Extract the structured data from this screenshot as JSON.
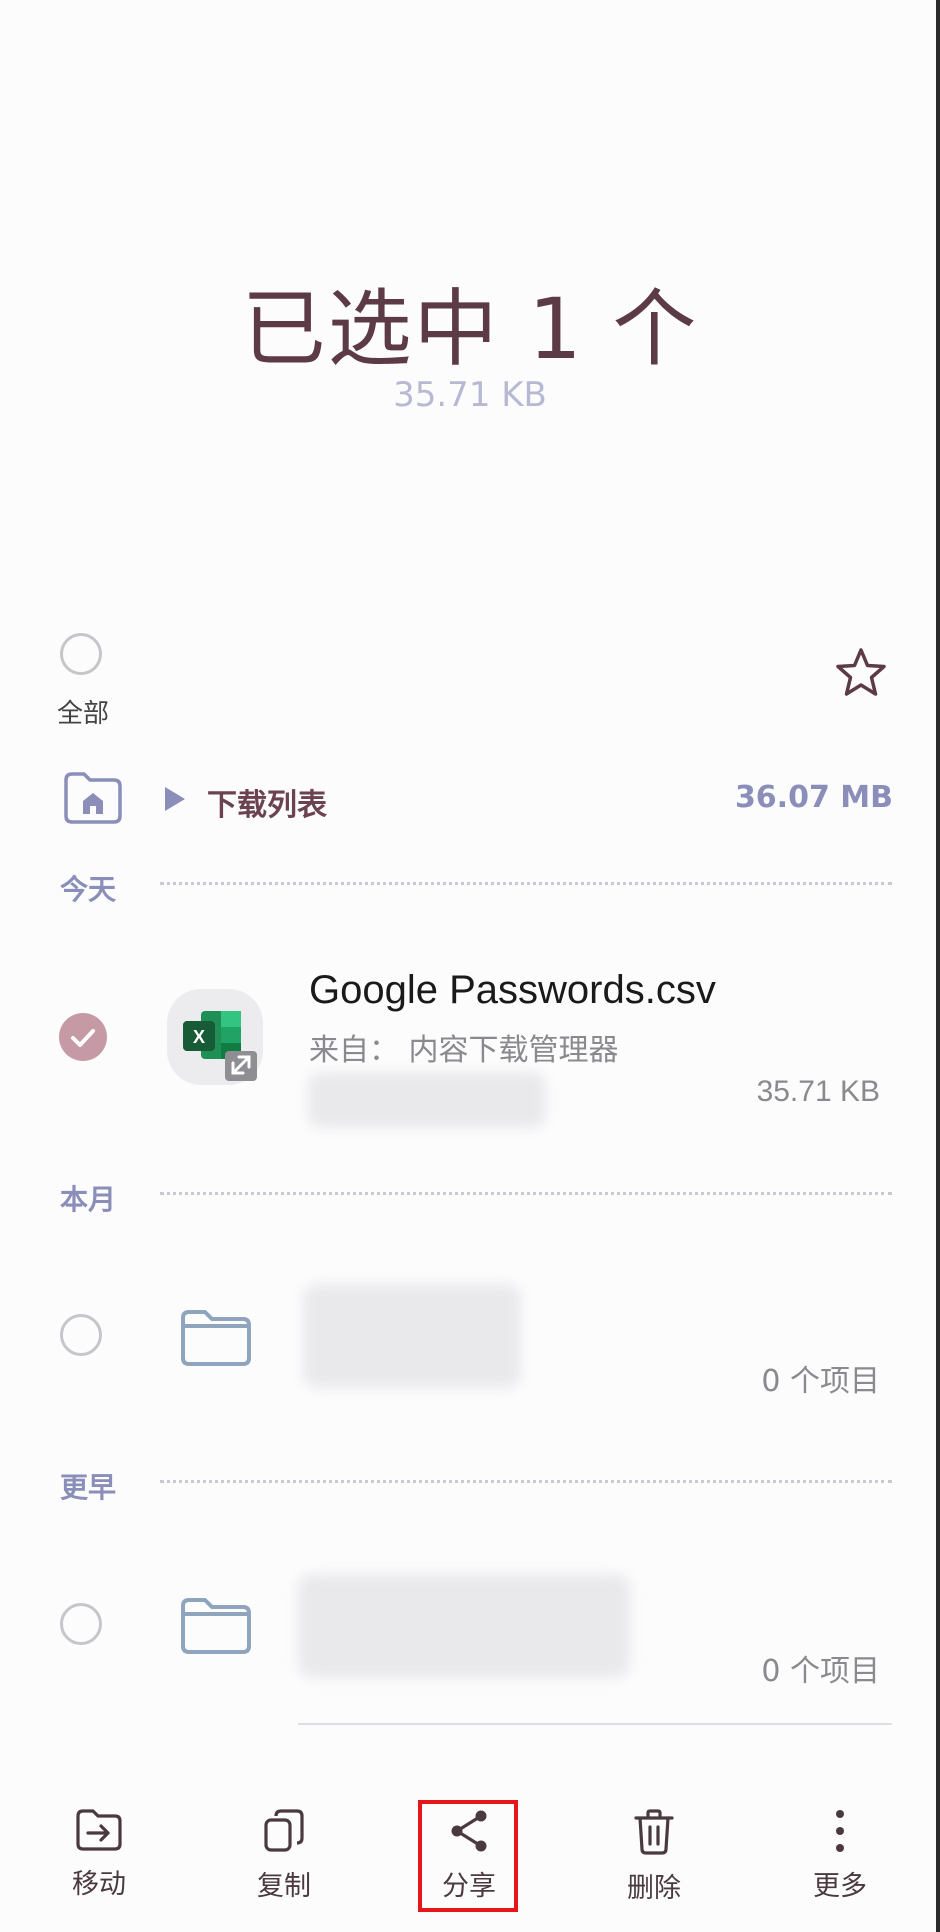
{
  "header": {
    "title": "已选中 1 个",
    "subtitle": "35.71 KB"
  },
  "select_all": {
    "label": "全部",
    "checked": false
  },
  "breadcrumb": {
    "current": "下载列表",
    "total_size": "36.07 MB"
  },
  "sections": {
    "today": "今天",
    "this_month": "本月",
    "earlier": "更早"
  },
  "files": [
    {
      "name": "Google Passwords.csv",
      "source": "来自： 内容下载管理器",
      "size": "35.71 KB",
      "selected": true,
      "icon": "excel-icon"
    }
  ],
  "folders": [
    {
      "count": "0 个项目",
      "selected": false,
      "icon": "folder-icon"
    },
    {
      "count": "0 个项目",
      "selected": false,
      "icon": "folder-icon"
    }
  ],
  "bottom_bar": {
    "move": "移动",
    "copy": "复制",
    "share": "分享",
    "delete": "删除",
    "more": "更多"
  },
  "colors": {
    "accent": "#5c3a46",
    "secondary": "#8a8eb8",
    "checked": "#c59aa4",
    "highlight": "#e5171b"
  }
}
